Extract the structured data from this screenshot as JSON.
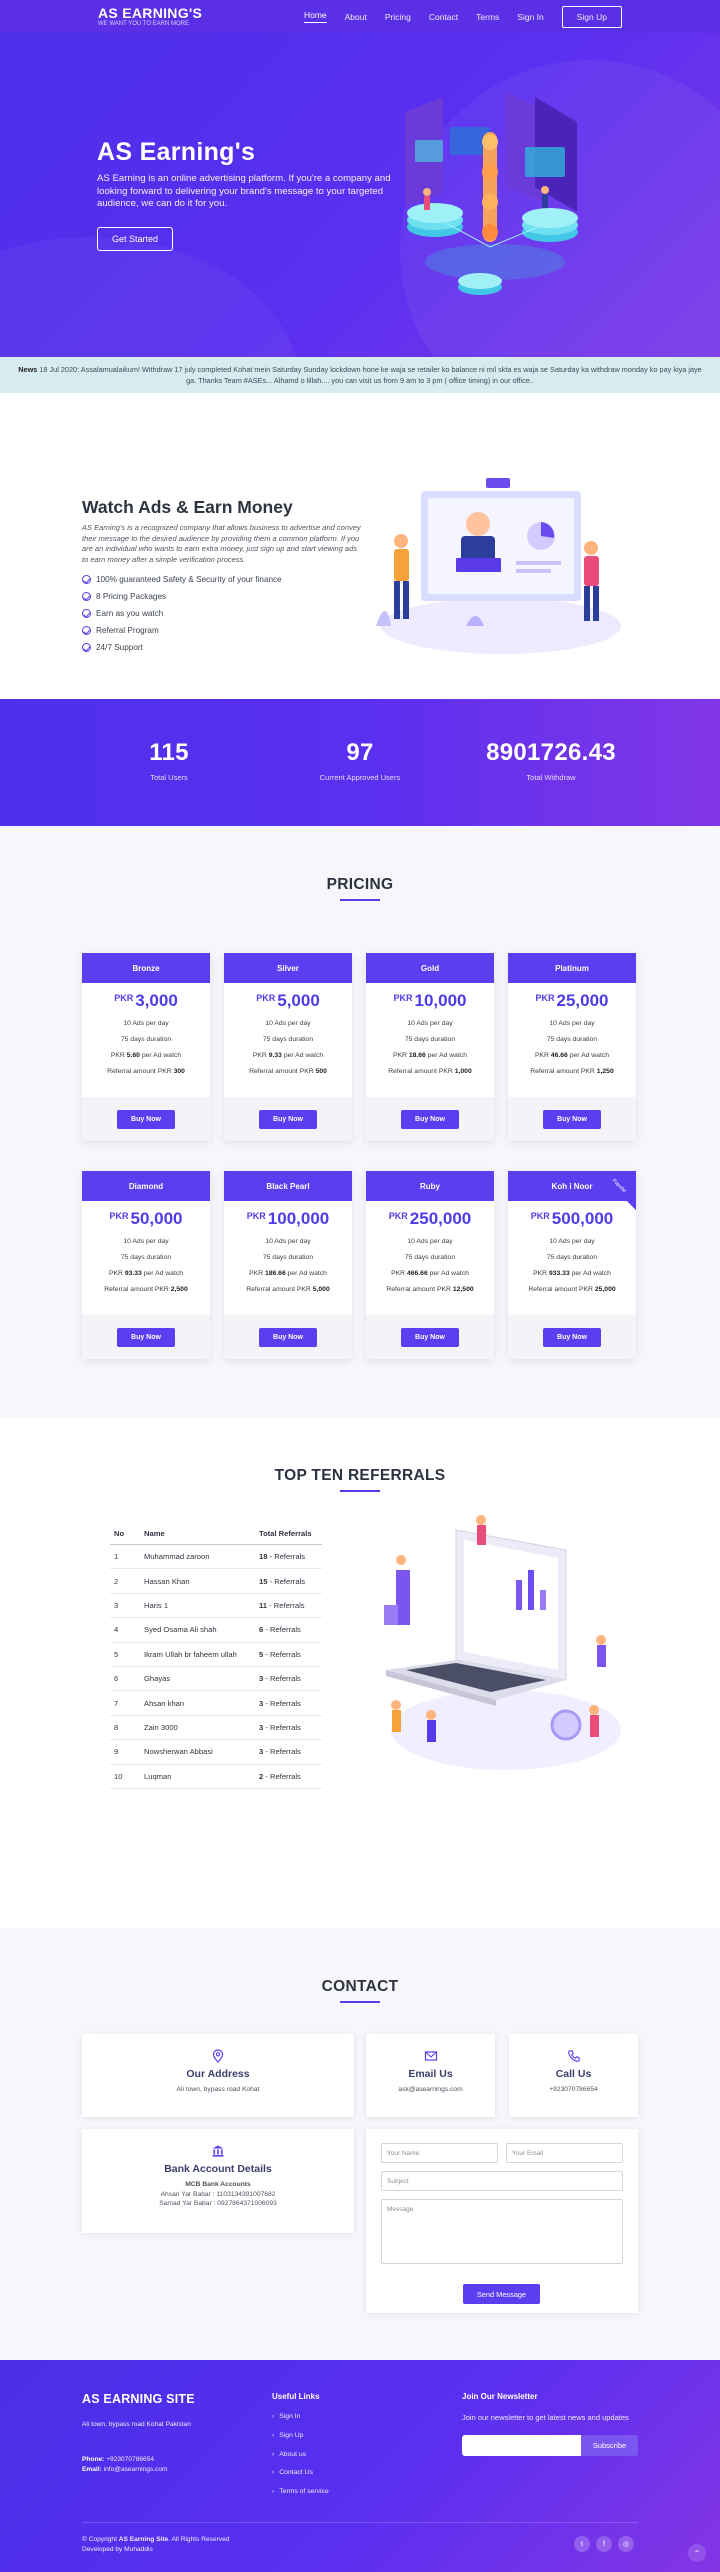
{
  "nav": {
    "brand_title": "AS EARNING'S",
    "brand_tagline": "WE WANT YOU TO EARN MORE",
    "links": [
      "Home",
      "About",
      "Pricing",
      "Contact",
      "Terms",
      "Sign In"
    ],
    "signup": "Sign Up"
  },
  "hero": {
    "title": "AS Earning's",
    "description": "AS Earning is an online advertising platform. If you're a company and looking forward to delivering your brand's message to your targeted audience, we can do it for you.",
    "cta": "Get Started"
  },
  "ticker": {
    "label": "News",
    "text": "18 Jul 2020: Assalamualaikum! Withdraw 17 july completed Kohat mein Saturday Sunday lockdown hone ke waja se retailer ko balance ni mil skta es waja se Saturday ka withdraw monday ko pay kiya jaye ga. Thanks Team #ASEs... Alhamd o lillah.... you can visit us from 9 am to 3 pm ( office timing) in our office.."
  },
  "watch": {
    "title": "Watch Ads & Earn Money",
    "description": "AS Earning's is a recognized company that allows business to advertise and convey their message to the desired audience by providing them a common platform. If you are an individual who wants to earn extra money, just sign up and start viewing ads to earn money after a simple verification process.",
    "features": [
      "100% guaranteed Safety & Security of your finance",
      "8 Pricing Packages",
      "Earn as you watch",
      "Referral Program",
      "24/7 Support"
    ]
  },
  "stats": [
    {
      "value": "115",
      "label": "Total Users"
    },
    {
      "value": "97",
      "label": "Current Approved Users"
    },
    {
      "value": "8901726.43",
      "label": "Total Withdraw"
    }
  ],
  "pricing": {
    "title": "PRICING",
    "currency": "PKR",
    "ads_line": "10 Ads per day",
    "duration_line": "75 days duration",
    "per_ad_suffix": "per Ad watch",
    "referral_prefix": "Referral amount PKR",
    "button": "Buy Now",
    "ribbon": "Popular",
    "plans": [
      {
        "name": "Bronze",
        "price": "3,000",
        "per_ad": "5.60",
        "referral": "300"
      },
      {
        "name": "Silver",
        "price": "5,000",
        "per_ad": "9.33",
        "referral": "500"
      },
      {
        "name": "Gold",
        "price": "10,000",
        "per_ad": "18.66",
        "referral": "1,000"
      },
      {
        "name": "Platinum",
        "price": "25,000",
        "per_ad": "46.66",
        "referral": "1,250"
      },
      {
        "name": "Diamond",
        "price": "50,000",
        "per_ad": "93.33",
        "referral": "2,500"
      },
      {
        "name": "Black Pearl",
        "price": "100,000",
        "per_ad": "186.66",
        "referral": "5,000"
      },
      {
        "name": "Ruby",
        "price": "250,000",
        "per_ad": "466.66",
        "referral": "12,500"
      },
      {
        "name": "Koh i Noor",
        "price": "500,000",
        "per_ad": "933.33",
        "referral": "25,000"
      }
    ]
  },
  "referrals": {
    "title": "TOP TEN REFERRALS",
    "headers": [
      "No",
      "Name",
      "Total Referrals"
    ],
    "suffix": "- Referrals",
    "rows": [
      {
        "no": "1",
        "name": "Muhammad zaroon",
        "count": "18"
      },
      {
        "no": "2",
        "name": "Hassan Khan",
        "count": "15"
      },
      {
        "no": "3",
        "name": "Haris 1",
        "count": "11"
      },
      {
        "no": "4",
        "name": "Syed Osama Ali shah",
        "count": "6"
      },
      {
        "no": "5",
        "name": "Ikram Ullah br faheem ullah",
        "count": "5"
      },
      {
        "no": "6",
        "name": "Ghayas",
        "count": "3"
      },
      {
        "no": "7",
        "name": "Ahsan khan",
        "count": "3"
      },
      {
        "no": "8",
        "name": "Zain 3000",
        "count": "3"
      },
      {
        "no": "9",
        "name": "Nowsherwan Abbasi",
        "count": "3"
      },
      {
        "no": "10",
        "name": "Luqman",
        "count": "2"
      }
    ]
  },
  "contact": {
    "title": "CONTACT",
    "address_title": "Our Address",
    "address": "Ali town, bypass road Kohat",
    "email_title": "Email Us",
    "email": "ask@asearnings.com",
    "call_title": "Call Us",
    "phone": "+923070786654",
    "bank_title": "Bank Account Details",
    "bank_name": "MCB Bank Accounts",
    "bank_line1": "Ahsan Yar Babar : 1103134391007682",
    "bank_line2": "Samad Yar Babar : 0927864371006093",
    "form": {
      "name_placeholder": "Your Name",
      "email_placeholder": "Your Email",
      "subject_placeholder": "Subject",
      "message_placeholder": "Message",
      "send": "Send Message"
    }
  },
  "footer": {
    "site": "AS EARNING SITE",
    "address": "Ali town, bypass road Kohat Pakistan",
    "phone_label": "Phone:",
    "phone": "+923070786654",
    "email_label": "Email:",
    "email": "info@asearnings.com",
    "links_title": "Useful Links",
    "links": [
      "Sign In",
      "Sign Up",
      "About us",
      "Contact Us",
      "Terms of service"
    ],
    "newsletter_title": "Join Our Newsletter",
    "newsletter_text": "Join our newsletter to get latest news and updates",
    "subscribe": "Subscribe",
    "copyright_prefix": "© Copyright",
    "copyright_site": "AS Earning Site",
    "copyright_suffix": ". All Rights Reserved",
    "developed": "Developed by Muhaddis",
    "social_icons": [
      "twitter-icon",
      "facebook-icon",
      "instagram-icon"
    ]
  },
  "colors": {
    "primary": "#5b3ef0",
    "hero": "#5a2ff0",
    "ticker_bg": "#d6ecf0"
  }
}
